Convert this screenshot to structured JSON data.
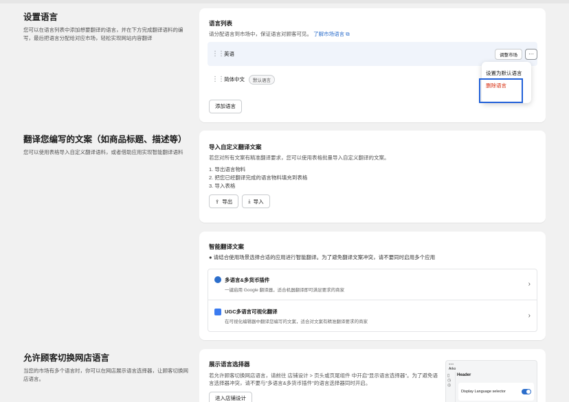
{
  "sec1": {
    "title": "设置语言",
    "desc": "您可以在语言列表中添加想要翻译的语言，并在下方完成翻译语料的编写，最后把语言分配给对应市场，轻松实现网站内容翻译"
  },
  "language_list": {
    "title": "语言列表",
    "subtitle": "请分配语言到市场中，保证语言对顾客可见。",
    "link": "了解市场语言",
    "rows": [
      {
        "name": "英语",
        "action": "调整市场",
        "more": "···"
      },
      {
        "name": "简体中文",
        "tag": "默认语言"
      }
    ],
    "add_button": "添加语言"
  },
  "menu": {
    "set_default": "设置为默认语言",
    "delete": "删除语言"
  },
  "sec2": {
    "title": "翻译您编写的文案（如商品标题、描述等）",
    "desc": "您可以使用表格导入自定义翻译语料，或者借助应用实现智能翻译语料"
  },
  "import_card": {
    "title": "导入自定义翻译文案",
    "subtitle": "若您对所有文案有精准翻译要求，您可以使用表格批量导入自定义翻译的文案。",
    "steps": [
      "1. 导出语言物料",
      "2. 把您已经翻译完成的语言物料填充到表格",
      "3. 导入表格"
    ],
    "export": "导出",
    "import": "导入"
  },
  "smart_card": {
    "title": "智能翻译文案",
    "notice": "请结合使用场景选择合适的应用进行智能翻译。为了避免翻译文案冲突，请不要同时启用多个应用",
    "apps": [
      {
        "name": "多语言&多货币插件",
        "desc": "一键启用 Google 翻译器，适合机器翻译即可满足要求的商家"
      },
      {
        "name": "UGC多语言可视化翻译",
        "desc": "在可视化编辑器中翻译您编写的文案，适合对文案有精准翻译要求的商家"
      }
    ]
  },
  "sec3": {
    "title": "允许顾客切换网店语言",
    "desc": "当您的市场有多个语言时，你可以在网店展示语言选择器，让顾客切换网店语言。"
  },
  "selector_card": {
    "title": "展示语言选择器",
    "desc": "若允许顾客切换网店语言，请前往 店铺设计 > 页头或页尾组件 中开启\"显示语言选择器\"。为了避免语言选择器冲突，请不要与\"多语言&多货币插件\"的语言选择器同时开启。",
    "button": "进入店铺设计",
    "preview": {
      "brand": "Arko",
      "header": "Header",
      "toggle_label": "Display Language selector"
    }
  },
  "colors": {
    "accent": "#2c6ecb",
    "danger": "#d72c0d",
    "highlight": "#1f5fd8"
  }
}
